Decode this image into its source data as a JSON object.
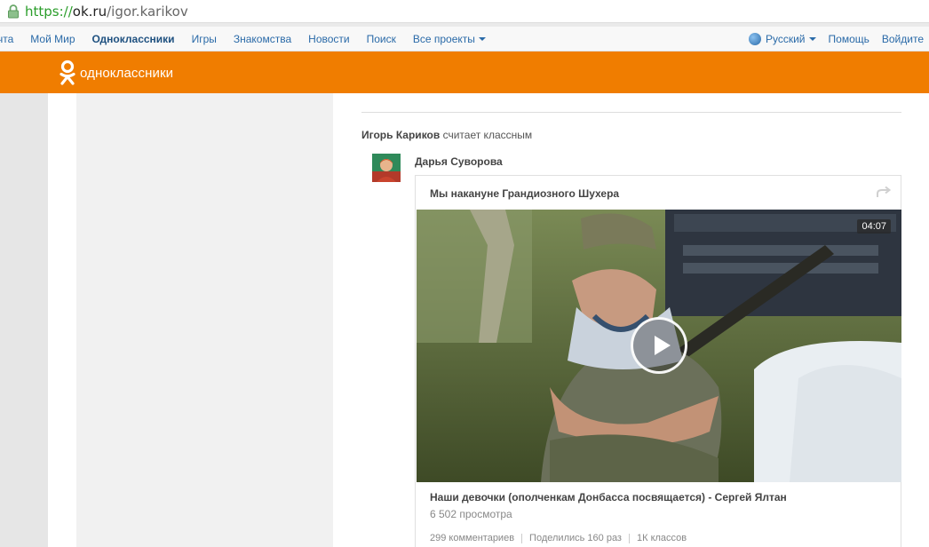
{
  "browser": {
    "url_scheme": "https://",
    "url_host": "ok.ru",
    "url_path": "/igor.karikov"
  },
  "topnav": {
    "items": [
      "чта",
      "Мой Мир",
      "Одноклассники",
      "Игры",
      "Знакомства",
      "Новости",
      "Поиск",
      "Все проекты"
    ],
    "active": "Одноклассники",
    "language": "Русский",
    "help": "Помощь",
    "login": "Войдите"
  },
  "header": {
    "logo_text": "одноклассники",
    "brand_color": "#f07d00"
  },
  "feed": {
    "activity_user": "Игорь Кариков",
    "activity_action": "считает классным",
    "author": "Дарья Суворова",
    "post_title": "Мы накануне Грандиозного Шухера",
    "video": {
      "duration": "04:07",
      "title": "Наши девочки (ополченкам Донбасса посвящается) - Сергей Ялтан",
      "views": "6 502 просмотра"
    },
    "stats": {
      "comments": "299 комментариев",
      "shares": "Поделились 160 раз",
      "likes": "1К классов"
    }
  }
}
